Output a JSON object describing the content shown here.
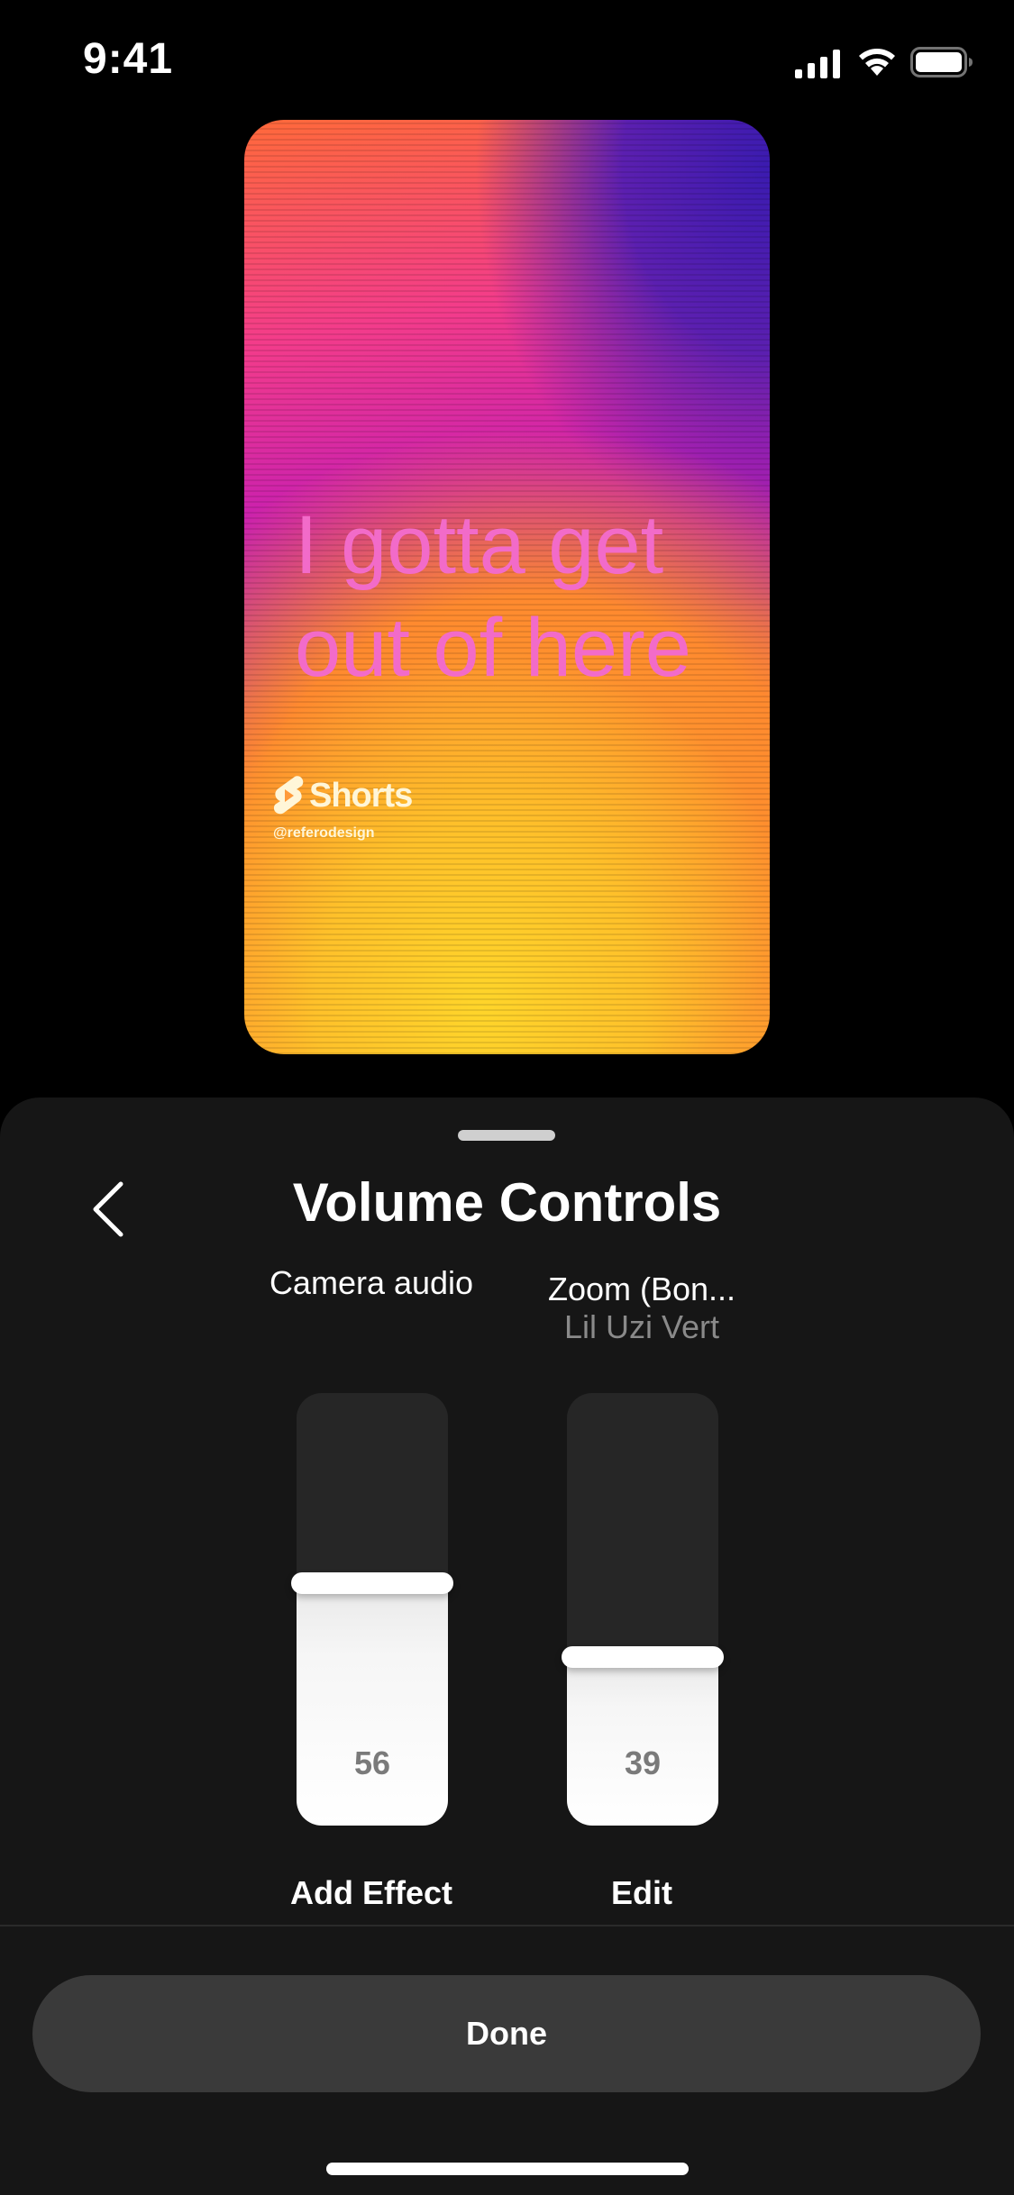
{
  "status_bar": {
    "time": "9:41",
    "icons": [
      "signal-icon",
      "wifi-icon",
      "battery-icon"
    ]
  },
  "preview": {
    "caption": "I gotta get out of here",
    "logo_text": "Shorts",
    "handle": "@referodesign",
    "colors": {
      "caption": "#f26bc9",
      "top": "#c81fb0",
      "bottom": "#ffc12a"
    }
  },
  "sheet": {
    "title": "Volume Controls",
    "back_icon": "chevron-left-icon",
    "tracks": [
      {
        "name": "Camera audio",
        "subtitle": "",
        "volume": 56,
        "action": "Add Effect"
      },
      {
        "name": "Zoom (Bon...",
        "subtitle": "Lil Uzi Vert",
        "volume": 39,
        "action": "Edit"
      }
    ],
    "done_label": "Done"
  },
  "colors": {
    "sheet_bg": "#161616",
    "slider_track": "#262626",
    "slider_fill": "#ffffff",
    "button_bg": "#3a3a3a"
  }
}
